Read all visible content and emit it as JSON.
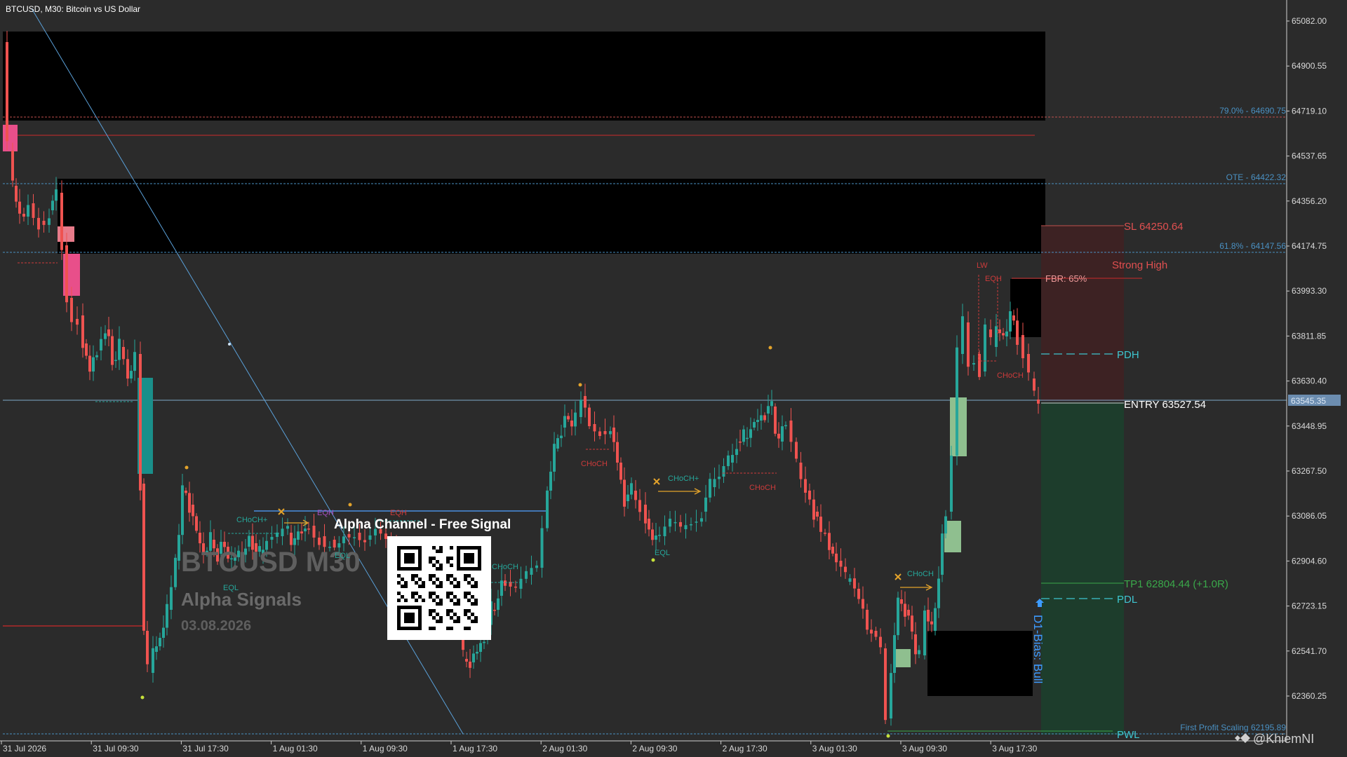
{
  "window": {
    "symbol_title": "BTCUSD, M30:  Bitcoin vs US Dollar",
    "watermark_symbol": "BTCUSD  M30",
    "watermark_brand": "Alpha Signals",
    "watermark_date": "03.08.2026",
    "qr_caption": "Alpha Channel - Free Signal",
    "credit": "@KhiemNI"
  },
  "price_axis": {
    "ticks": [
      "65082.00",
      "64900.55",
      "64719.10",
      "64537.65",
      "64356.20",
      "64174.75",
      "63993.30",
      "63811.85",
      "63630.40",
      "63448.95",
      "63267.50",
      "63086.05",
      "62904.60",
      "62723.15",
      "62541.70",
      "62360.25"
    ],
    "current_price": "63545.35"
  },
  "time_axis": {
    "ticks": [
      "31 Jul 2026",
      "31 Jul 09:30",
      "31 Jul 17:30",
      "1 Aug 01:30",
      "1 Aug 09:30",
      "1 Aug 17:30",
      "2 Aug 01:30",
      "2 Aug 09:30",
      "2 Aug 17:30",
      "3 Aug 01:30",
      "3 Aug 09:30",
      "3 Aug 17:30"
    ]
  },
  "fib_levels": {
    "fib79": "79.0% - 64690.75",
    "ote": "OTE - 64422.32",
    "fib618": "61.8% - 64147.56",
    "first_profit": "First Profit Scaling 62195.89"
  },
  "trade": {
    "sl": "SL 64250.64",
    "entry": "ENTRY 63527.54",
    "tp1": "TP1 62804.44 (+1.0R)",
    "strong_high": "Strong High",
    "fbr": "FBR: 65%",
    "pdh": "PDH",
    "pdl": "PDL",
    "pwl": "PWL",
    "bias": "D1-Bias: Bull"
  },
  "structure_labels": {
    "choch": "CHoCH",
    "choch_plus": "CHoCH+",
    "eqh": "EQH",
    "eql": "EQL",
    "lw": "LW"
  },
  "colors": {
    "bull": "#26a69a",
    "bear": "#ef5350",
    "background": "#2b2b2b",
    "fib": "#4a90c2",
    "sl_zone": "#3d2223",
    "tp_zone": "#1d3d2c"
  }
}
